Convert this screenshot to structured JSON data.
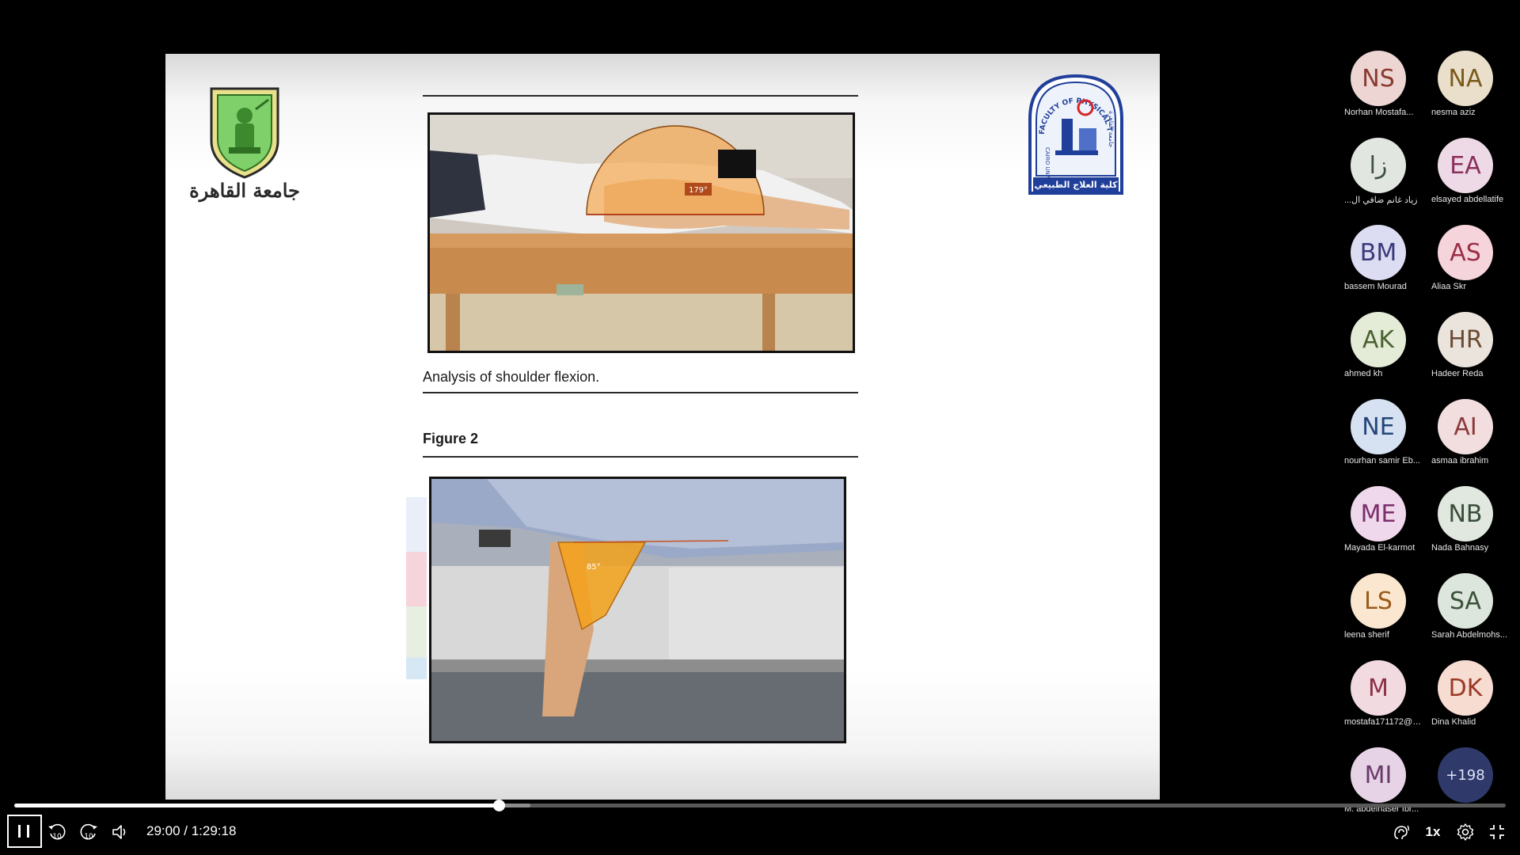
{
  "slide": {
    "logo_left_caption": "جامعة القاهرة",
    "logo_right_ring_text": "FACULTY OF PHYSICAL THERAPY",
    "logo_right_banner": "كلية العلاج الطبيعي",
    "logo_right_side_left": "CAIRO UNIV.",
    "logo_right_side_right": "جامعة القاهرة",
    "caption1": "Analysis of shoulder flexion.",
    "figure_label": "Figure 2",
    "angle1": "179°",
    "angle2": "85°"
  },
  "participants": [
    {
      "initials": "NS",
      "name": "Norhan Mostafa...",
      "bg": "#ecd5d3",
      "fg": "#8a3a2e"
    },
    {
      "initials": "NA",
      "name": "nesma aziz",
      "bg": "#e9dfca",
      "fg": "#7a5a1c"
    },
    {
      "initials": "زا",
      "name": "...زياد غانم ضافي ال",
      "bg": "#e1e6e0",
      "fg": "#3e4e3e"
    },
    {
      "initials": "EA",
      "name": "elsayed abdellatife",
      "bg": "#eed9e6",
      "fg": "#8a2e5c"
    },
    {
      "initials": "BM",
      "name": "bassem Mourad",
      "bg": "#dcdcf2",
      "fg": "#3a3a7a"
    },
    {
      "initials": "AS",
      "name": "Aliaa Skr",
      "bg": "#f6d4dc",
      "fg": "#9a2e46"
    },
    {
      "initials": "AK",
      "name": "ahmed kh",
      "bg": "#e4ecd8",
      "fg": "#4a6230"
    },
    {
      "initials": "HR",
      "name": "Hadeer Reda",
      "bg": "#ebe4dc",
      "fg": "#6a4a34"
    },
    {
      "initials": "NE",
      "name": "nourhan samir Eb...",
      "bg": "#d6e2f2",
      "fg": "#25457a"
    },
    {
      "initials": "AI",
      "name": "asmaa ibrahim",
      "bg": "#f2dede",
      "fg": "#8a3a3a"
    },
    {
      "initials": "ME",
      "name": "Mayada El-karmot",
      "bg": "#f0d8ec",
      "fg": "#7a2e6a"
    },
    {
      "initials": "NB",
      "name": "Nada Bahnasy",
      "bg": "#e0e8e0",
      "fg": "#3a4e3a"
    },
    {
      "initials": "LS",
      "name": "leena sherif",
      "bg": "#fbe7cf",
      "fg": "#9a5a1a"
    },
    {
      "initials": "SA",
      "name": "Sarah Abdelmohs...",
      "bg": "#dde6dc",
      "fg": "#3a523a"
    },
    {
      "initials": "M",
      "name": "mostafa171172@b...",
      "bg": "#f1dbe0",
      "fg": "#8a3046"
    },
    {
      "initials": "DK",
      "name": "Dina Khalid",
      "bg": "#f7dcd2",
      "fg": "#9a3a26"
    },
    {
      "initials": "MI",
      "name": "M. abdelnaser Ibr...",
      "bg": "#e6d4e6",
      "fg": "#6a3a6a"
    },
    {
      "initials": "+198",
      "name": "",
      "bg": "#2f3a6b",
      "fg": "#dfe3f5"
    }
  ],
  "player": {
    "current_time": "29:00",
    "separator": " / ",
    "duration": "1:29:18",
    "progress_fraction": 0.325,
    "buffered_fraction": 0.346,
    "speed_label": "1x",
    "rewind_label": "10",
    "forward_label": "10"
  }
}
